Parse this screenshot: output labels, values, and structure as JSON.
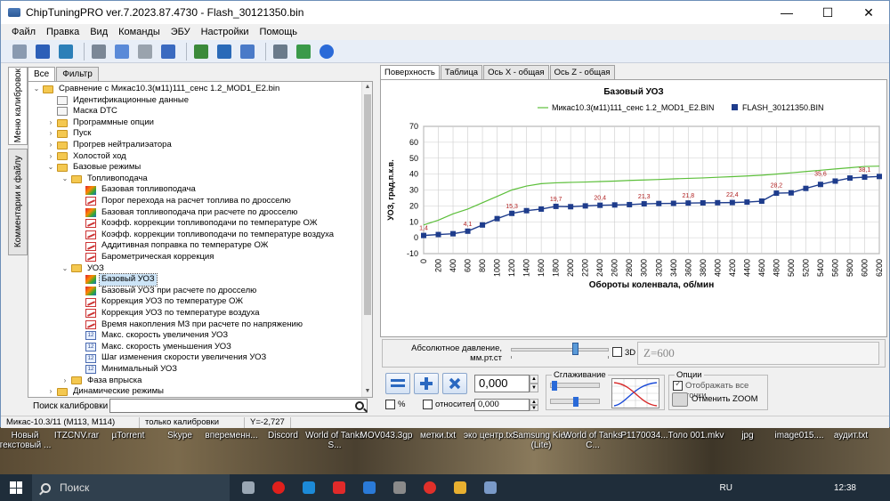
{
  "window": {
    "title": "ChipTuningPRO ver.7.2023.87.4730 - Flash_30121350.bin",
    "controls": {
      "minimize": "—",
      "maximize": "☐",
      "close": "✕"
    }
  },
  "menu": [
    "Файл",
    "Правка",
    "Вид",
    "Команды",
    "ЭБУ",
    "Настройки",
    "Помощь"
  ],
  "toolbar_icons": [
    "open-icon",
    "save-icon",
    "save-as-icon",
    "print-icon",
    "copy-icon",
    "paste-icon",
    "undo-icon",
    "compare-icon",
    "checksum-icon",
    "find-icon",
    "tools-icon",
    "ecu-icon",
    "help-icon"
  ],
  "side_tabs": [
    "Меню калибровок",
    "Комментарии к файлу"
  ],
  "left_tabs": [
    "Все",
    "Фильтр"
  ],
  "tree": [
    {
      "depth": 0,
      "expander": "⌄",
      "icon": "folder",
      "label": "Сравнение с Микас10.3(м11)111_сенс 1.2_MOD1_E2.bin"
    },
    {
      "depth": 1,
      "expander": "",
      "icon": "doc",
      "label": "Идентификационные данные"
    },
    {
      "depth": 1,
      "expander": "",
      "icon": "doc",
      "label": "Маска DTC"
    },
    {
      "depth": 1,
      "expander": "›",
      "icon": "folder",
      "label": "Программные опции"
    },
    {
      "depth": 1,
      "expander": "›",
      "icon": "folder",
      "label": "Пуск"
    },
    {
      "depth": 1,
      "expander": "›",
      "icon": "folder",
      "label": "Прогрев нейтралиэатора"
    },
    {
      "depth": 1,
      "expander": "›",
      "icon": "folder",
      "label": "Холостой ход"
    },
    {
      "depth": 1,
      "expander": "⌄",
      "icon": "folder",
      "label": "Базовые режимы"
    },
    {
      "depth": 2,
      "expander": "⌄",
      "icon": "folder",
      "label": "Топливоподача"
    },
    {
      "depth": 3,
      "expander": "",
      "icon": "chart",
      "label": "Базовая топливоподача"
    },
    {
      "depth": 3,
      "expander": "",
      "icon": "curve",
      "label": "Порог перехода на расчет топлива по дросселю"
    },
    {
      "depth": 3,
      "expander": "",
      "icon": "chart",
      "label": "Базовая топливоподача при расчете по дросселю"
    },
    {
      "depth": 3,
      "expander": "",
      "icon": "curve",
      "label": "Коэфф. коррекции топливоподачи по температуре ОЖ"
    },
    {
      "depth": 3,
      "expander": "",
      "icon": "curve",
      "label": "Коэфф. коррекции топливоподачи по температуре воздуха"
    },
    {
      "depth": 3,
      "expander": "",
      "icon": "curve",
      "label": "Аддитивная поправка по температуре ОЖ"
    },
    {
      "depth": 3,
      "expander": "",
      "icon": "curve",
      "label": "Барометрическая коррекция"
    },
    {
      "depth": 2,
      "expander": "⌄",
      "icon": "folder",
      "label": "УОЗ"
    },
    {
      "depth": 3,
      "expander": "",
      "icon": "chart",
      "label": "Базовый УОЗ",
      "selected": true
    },
    {
      "depth": 3,
      "expander": "",
      "icon": "chart",
      "label": "Базовый УОЗ при расчете по дросселю"
    },
    {
      "depth": 3,
      "expander": "",
      "icon": "curve",
      "label": "Коррекция УОЗ по температуре ОЖ"
    },
    {
      "depth": 3,
      "expander": "",
      "icon": "curve",
      "label": "Коррекция УОЗ по температуре воздуха"
    },
    {
      "depth": 3,
      "expander": "",
      "icon": "curve",
      "label": "Время накопления МЗ при расчете по напряжению"
    },
    {
      "depth": 3,
      "expander": "",
      "icon": "param",
      "label": "Макс. скорость увеличения УОЗ"
    },
    {
      "depth": 3,
      "expander": "",
      "icon": "param",
      "label": "Макс. скорость уменьшения УОЗ"
    },
    {
      "depth": 3,
      "expander": "",
      "icon": "param",
      "label": "Шаг изменения скорости увеличения УОЗ"
    },
    {
      "depth": 3,
      "expander": "",
      "icon": "param",
      "label": "Минимальный УОЗ"
    },
    {
      "depth": 2,
      "expander": "›",
      "icon": "folder",
      "label": "Фаза впрыска"
    },
    {
      "depth": 1,
      "expander": "›",
      "icon": "folder",
      "label": "Динамические режимы"
    }
  ],
  "search": {
    "label": "Поиск калибровки",
    "value": ""
  },
  "right_tabs": [
    "Поверхность",
    "Таблица",
    "Ось X - общая",
    "Ось Z - общая"
  ],
  "chart_data": {
    "type": "line",
    "title": "Базовый УОЗ",
    "xlabel": "Обороты коленвала, об/мин",
    "ylabel": "УОЗ, град.п.к.в.",
    "ylim": [
      -10,
      70
    ],
    "xlim": [
      0,
      6200
    ],
    "yticks": [
      -10,
      0,
      10,
      20,
      30,
      40,
      50,
      60,
      70
    ],
    "xticks": [
      0,
      200,
      400,
      600,
      800,
      1000,
      1200,
      1400,
      1600,
      1800,
      2000,
      2200,
      2400,
      2600,
      2800,
      3000,
      3200,
      3400,
      3600,
      3800,
      4000,
      4200,
      4400,
      4600,
      4800,
      5000,
      5200,
      5400,
      5600,
      5800,
      6000,
      6200
    ],
    "grid": true,
    "legend_position": "top",
    "series": [
      {
        "name": "Микас10.3(м11)111_сенс 1.2_MOD1_E2.BIN",
        "color": "#5cbf3a",
        "marker": "none",
        "x": [
          0,
          200,
          400,
          600,
          800,
          1000,
          1200,
          1400,
          1600,
          1800,
          2000,
          2200,
          2400,
          2600,
          2800,
          3000,
          3200,
          3400,
          3600,
          3800,
          4000,
          4200,
          4400,
          4600,
          4800,
          5000,
          5200,
          5400,
          5600,
          5800,
          6000,
          6200
        ],
        "y": [
          8,
          11,
          15,
          18,
          22,
          26,
          30,
          32.5,
          34,
          34.5,
          34.8,
          35,
          35.3,
          35.6,
          36,
          36.3,
          36.6,
          37,
          37.3,
          37.6,
          38,
          38.4,
          38.8,
          39.3,
          40,
          40.8,
          41.6,
          42.4,
          43.2,
          44,
          44.8,
          45
        ]
      },
      {
        "name": "FLASH_30121350.BIN",
        "color": "#1e3c8c",
        "marker": "square",
        "x": [
          0,
          200,
          400,
          600,
          800,
          1000,
          1200,
          1400,
          1600,
          1800,
          2000,
          2200,
          2400,
          2600,
          2800,
          3000,
          3200,
          3400,
          3600,
          3800,
          4000,
          4200,
          4400,
          4600,
          4800,
          5000,
          5200,
          5400,
          5600,
          5800,
          6000,
          6200
        ],
        "y": [
          1.4,
          2,
          2.5,
          4.1,
          8,
          12,
          15.3,
          17,
          18,
          19.7,
          19.5,
          20,
          20.4,
          20.6,
          20.8,
          21.3,
          21.5,
          21.6,
          21.8,
          21.9,
          22,
          22.1,
          22.4,
          23,
          28,
          28.2,
          31,
          33.5,
          35.6,
          37.5,
          38.1,
          38.5
        ]
      }
    ],
    "data_labels": [
      {
        "x": 0,
        "y": 1.4,
        "text": "1,4"
      },
      {
        "x": 600,
        "y": 4.1,
        "text": "4,1"
      },
      {
        "x": 1200,
        "y": 15.3,
        "text": "15,3"
      },
      {
        "x": 1800,
        "y": 19.7,
        "text": "19,7"
      },
      {
        "x": 2400,
        "y": 20.4,
        "text": "20,4"
      },
      {
        "x": 3000,
        "y": 21.3,
        "text": "21,3"
      },
      {
        "x": 3600,
        "y": 21.8,
        "text": "21,8"
      },
      {
        "x": 4200,
        "y": 22.4,
        "text": "22,4"
      },
      {
        "x": 4800,
        "y": 28.2,
        "text": "28,2"
      },
      {
        "x": 5400,
        "y": 35.6,
        "text": "35,6"
      },
      {
        "x": 6000,
        "y": 38.1,
        "text": "38,1"
      }
    ]
  },
  "controls": {
    "pressure_label": "Абсолютное давление,",
    "pressure_unit": "мм.рт.ст",
    "pressure_slider_fraction": 0.66,
    "chk_3d": "3D",
    "z_value": "Z=600",
    "value_main": "0,000",
    "value_relative": "0,000",
    "pct_label": "%",
    "relative_label": "относительно",
    "smoothing_label": "Сглаживание",
    "options_label": "Опции",
    "show_all_points": "Отображать все точки",
    "undo_zoom": "Отменить ZOOM"
  },
  "status": [
    "Микас-10.3/11 (M113, M114)",
    "только калибровки",
    "Y=-2,727"
  ],
  "desktop_icons": [
    "Новый текстовый ...",
    "ITZCNV.rar",
    "µTorrent",
    "Skype",
    "впеременн...",
    "Discord",
    "World of Tanks S...",
    "MOV043.3gp",
    "метки.txt",
    "эко центр.txt",
    "Samsung Kies (Lite)",
    "World of Tanks C...",
    "P1170034...",
    "Толо 001.mkv",
    "jpg",
    "image015....",
    "аудит.txt"
  ],
  "taskbar": {
    "search_placeholder": "Поиск",
    "apps": [
      "task-view-icon",
      "opera-icon",
      "edge-icon",
      "yandex-icon",
      "mail-icon",
      "settings-icon",
      "yandex-browser-icon",
      "explorer-icon",
      "chiptuning-icon"
    ],
    "lang": "RU",
    "time": "12:38"
  }
}
